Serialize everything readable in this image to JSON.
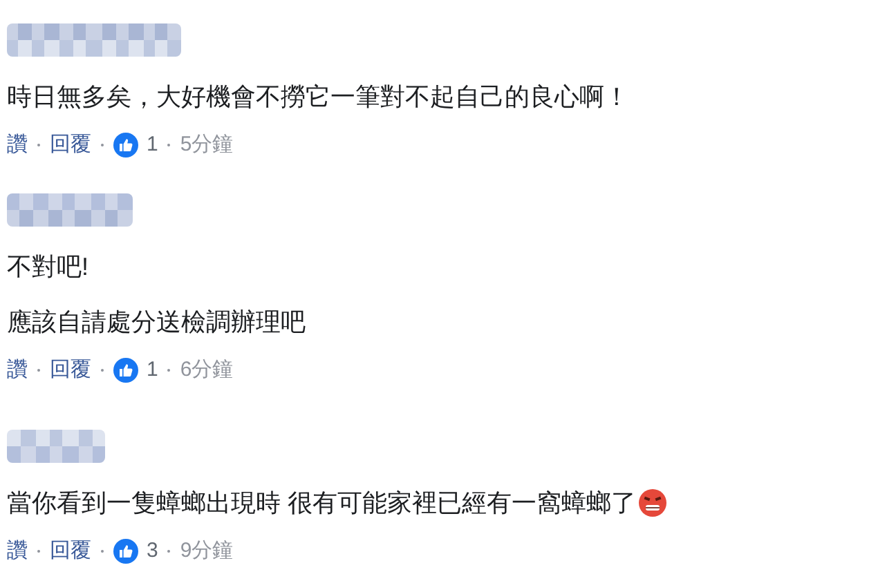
{
  "comments": [
    {
      "lines": [
        "時日無多矣，大好機會不撈它一筆對不起自己的良心啊！"
      ],
      "emoji": false,
      "actions": {
        "like": "讚",
        "reply": "回覆",
        "reaction_count": "1",
        "time": "5分鐘"
      }
    },
    {
      "lines": [
        "不對吧!",
        "應該自請處分送檢調辦理吧"
      ],
      "emoji": false,
      "actions": {
        "like": "讚",
        "reply": "回覆",
        "reaction_count": "1",
        "time": "6分鐘"
      }
    },
    {
      "lines": [
        "當你看到一隻蟑螂出現時 很有可能家裡已經有一窩蟑螂了"
      ],
      "emoji": true,
      "actions": {
        "like": "讚",
        "reply": "回覆",
        "reaction_count": "3",
        "time": "9分鐘"
      }
    }
  ]
}
